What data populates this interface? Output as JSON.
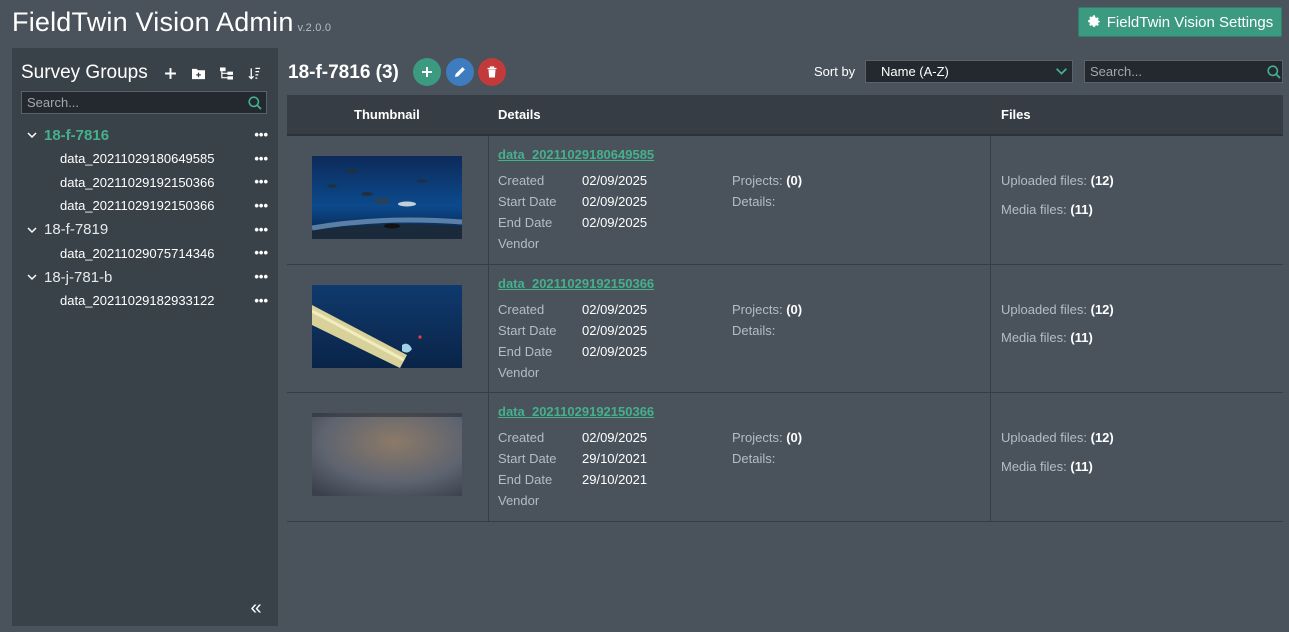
{
  "app": {
    "title": "FieldTwin Vision Admin",
    "version": "v.2.0.0",
    "settings_label": "FieldTwin Vision Settings"
  },
  "sidebar": {
    "title": "Survey Groups",
    "search_placeholder": "Search...",
    "tools": [
      "plus-icon",
      "folder-add-icon",
      "tree-icon",
      "sort-icon"
    ],
    "groups": [
      {
        "label": "18-f-7816",
        "active": true,
        "items": [
          "data_20211029180649585",
          "data_20211029192150366",
          "data_20211029192150366"
        ]
      },
      {
        "label": "18-f-7819",
        "active": false,
        "items": [
          "data_20211029075714346"
        ]
      },
      {
        "label": "18-j-781-b",
        "active": false,
        "items": [
          "data_20211029182933122"
        ]
      }
    ],
    "dots": "•••",
    "collapse_label": "«"
  },
  "main": {
    "group_title": "18-f-7816 (3)",
    "sort_label": "Sort by",
    "sort_value": "Name (A-Z)",
    "search_placeholder": "Search...",
    "columns": {
      "thumbnail": "Thumbnail",
      "details": "Details",
      "files": "Files"
    },
    "labels": {
      "created": "Created",
      "start_date": "Start Date",
      "end_date": "End Date",
      "vendor": "Vendor",
      "projects": "Projects:",
      "details": "Details:",
      "uploaded": "Uploaded files:",
      "media": "Media files:"
    },
    "rows": [
      {
        "name": "data_20211029180649585",
        "created": "02/09/2025",
        "start": "02/09/2025",
        "end": "02/09/2025",
        "projects": "(0)",
        "uploaded": "(12)",
        "media": "(11)"
      },
      {
        "name": "data_20211029192150366",
        "created": "02/09/2025",
        "start": "02/09/2025",
        "end": "02/09/2025",
        "projects": "(0)",
        "uploaded": "(12)",
        "media": "(11)"
      },
      {
        "name": "data_20211029192150366",
        "created": "02/09/2025",
        "start": "29/10/2021",
        "end": "29/10/2021",
        "projects": "(0)",
        "uploaded": "(12)",
        "media": "(11)"
      }
    ]
  },
  "colors": {
    "accent": "#3c9a80",
    "link": "#45b08c",
    "edit": "#3e7cc0",
    "delete": "#c23a3a",
    "background": "#4a535c",
    "panel": "#3a4249"
  }
}
